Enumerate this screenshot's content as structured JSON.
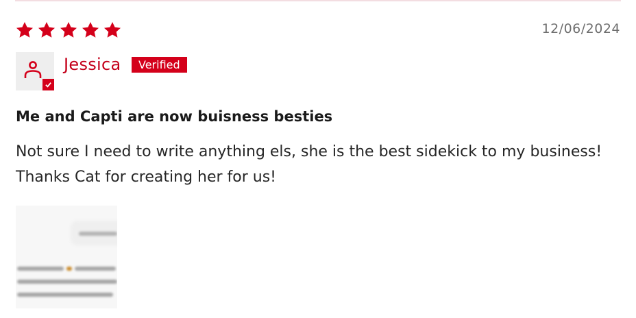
{
  "review": {
    "rating": 5,
    "max_rating": 5,
    "date": "12/06/2024",
    "author": "Jessica",
    "verified_label": "Verified",
    "title": "Me and Capti are now buisness besties",
    "body": "Not sure I need to write anything els, she is the best sidekick to my business! Thanks Cat for creating her for us!",
    "attachment": {
      "type": "screenshot-thumbnail",
      "blurred": true
    }
  },
  "icons": {
    "star": "star-icon",
    "avatar": "user-icon",
    "verified_check": "check-icon"
  },
  "colors": {
    "accent": "#d4001a",
    "author_text": "#c4001a",
    "date_text": "#6e6e6e",
    "avatar_bg": "#eeeeee",
    "divider": "#f3dde1"
  }
}
